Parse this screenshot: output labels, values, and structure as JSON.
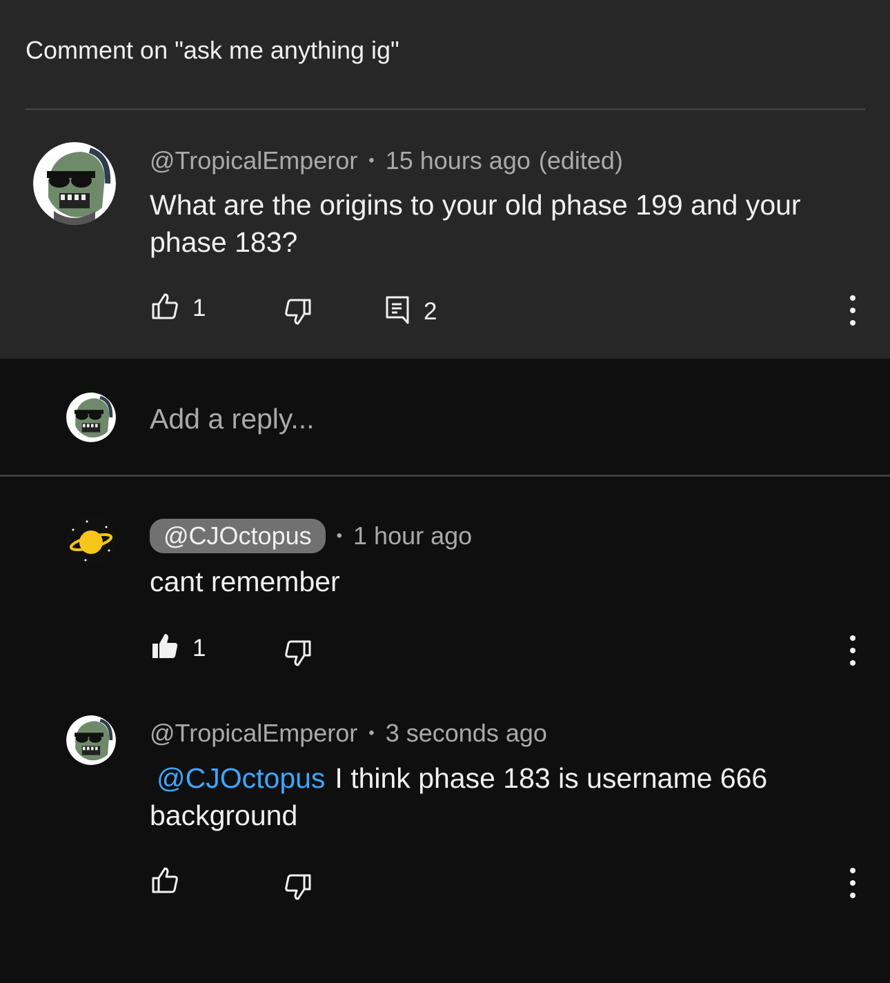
{
  "header": {
    "title": "Comment on \"ask me anything ig\""
  },
  "comment": {
    "author": "@TropicalEmperor",
    "time": "15 hours ago",
    "edited": "(edited)",
    "text": "What are the origins to your old phase 199 and your phase 183?",
    "likes": "1",
    "replies": "2"
  },
  "reply_input": {
    "placeholder": "Add a reply..."
  },
  "replies": [
    {
      "author": "@CJOctopus",
      "time": "1 hour ago",
      "text": "cant remember",
      "likes": "1"
    },
    {
      "author": "@TropicalEmperor",
      "time": "3 seconds ago",
      "mention": "@CJOctopus",
      "text": "I think phase 183 is username 666 background"
    }
  ],
  "icons": {
    "like": "thumbs-up-icon",
    "like_filled": "thumbs-up-filled-icon",
    "dislike": "thumbs-down-icon",
    "replies": "comment-icon",
    "more": "more-vertical-icon"
  },
  "colors": {
    "top_panel": "#272727",
    "background": "#0f0f0f",
    "mention": "#3ea6ff",
    "chip": "#717171"
  }
}
